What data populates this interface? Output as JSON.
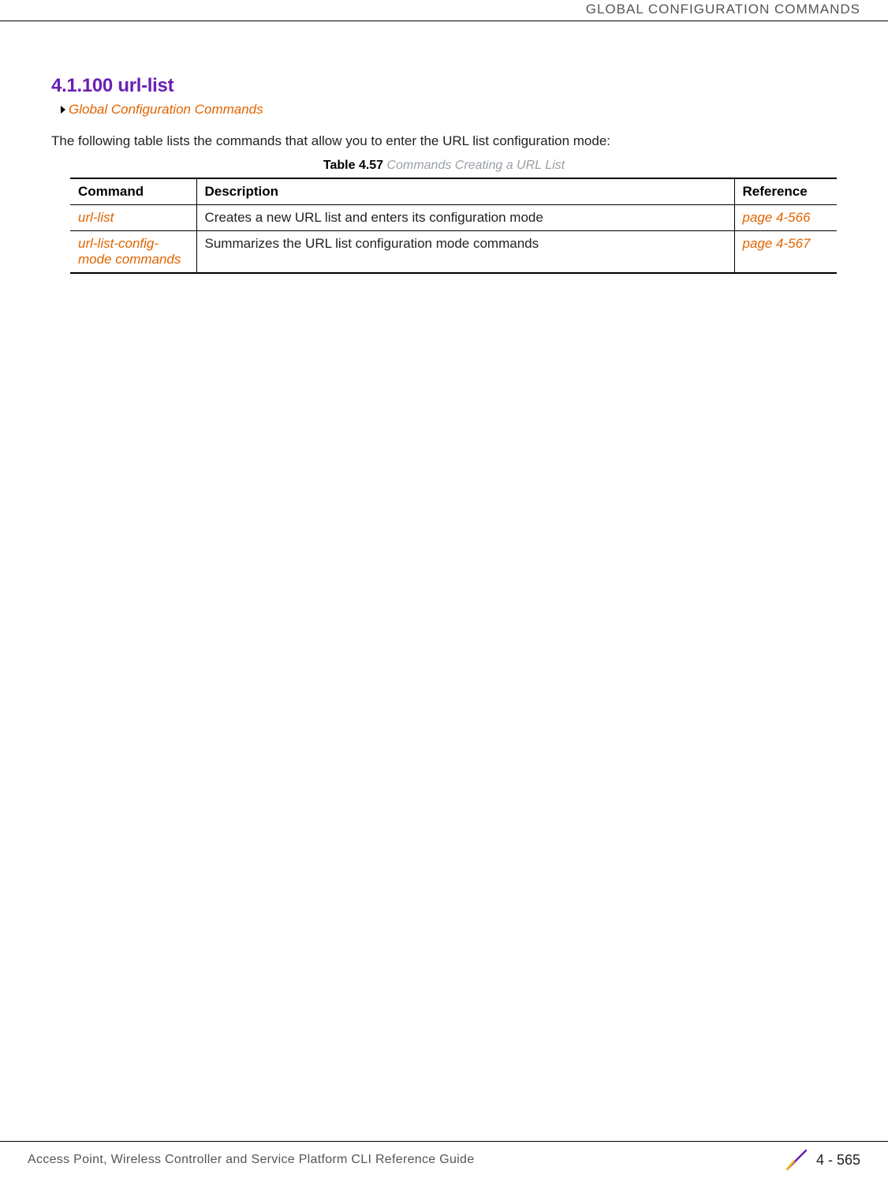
{
  "header": {
    "chapter": "GLOBAL CONFIGURATION COMMANDS"
  },
  "section": {
    "number_title": "4.1.100 url-list",
    "breadcrumb": "Global Configuration Commands",
    "intro": "The following table lists the commands that allow you to enter the URL list configuration mode:"
  },
  "table": {
    "caption_label": "Table 4.57",
    "caption_title": "Commands Creating a URL List",
    "headers": {
      "command": "Command",
      "description": "Description",
      "reference": "Reference"
    },
    "rows": [
      {
        "command": "url-list",
        "description": "Creates a new URL list and enters its configuration mode",
        "reference": "page 4-566"
      },
      {
        "command": "url-list-config-mode commands",
        "description": "Summarizes the URL list configuration mode commands",
        "reference": "page 4-567"
      }
    ]
  },
  "footer": {
    "guide": "Access Point, Wireless Controller and Service Platform CLI Reference Guide",
    "pagenum": "4 - 565"
  }
}
